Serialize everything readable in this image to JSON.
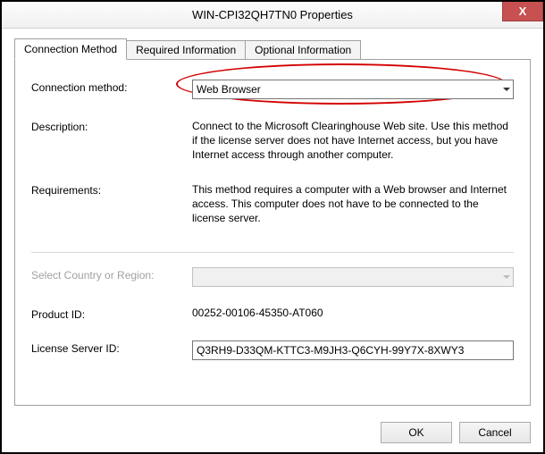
{
  "window": {
    "title": "WIN-CPI32QH7TN0 Properties",
    "close_glyph": "X"
  },
  "tabs": [
    {
      "label": "Connection Method",
      "active": true
    },
    {
      "label": "Required Information",
      "active": false
    },
    {
      "label": "Optional Information",
      "active": false
    }
  ],
  "fields": {
    "connection_method": {
      "label": "Connection method:",
      "value": "Web Browser"
    },
    "description": {
      "label": "Description:",
      "value": "Connect to the Microsoft Clearinghouse Web site. Use this method if the license server does not have Internet access, but you have Internet access through another computer."
    },
    "requirements": {
      "label": "Requirements:",
      "value": "This method requires a computer with a Web browser and Internet access. This computer does not have to be connected to the license server."
    },
    "country": {
      "label": "Select Country or Region:",
      "value": ""
    },
    "product_id": {
      "label": "Product ID:",
      "value": "00252-00106-45350-AT060"
    },
    "license_server_id": {
      "label": "License Server ID:",
      "value": "Q3RH9-D33QM-KTTC3-M9JH3-Q6CYH-99Y7X-8XWY3"
    }
  },
  "buttons": {
    "ok": "OK",
    "cancel": "Cancel"
  }
}
